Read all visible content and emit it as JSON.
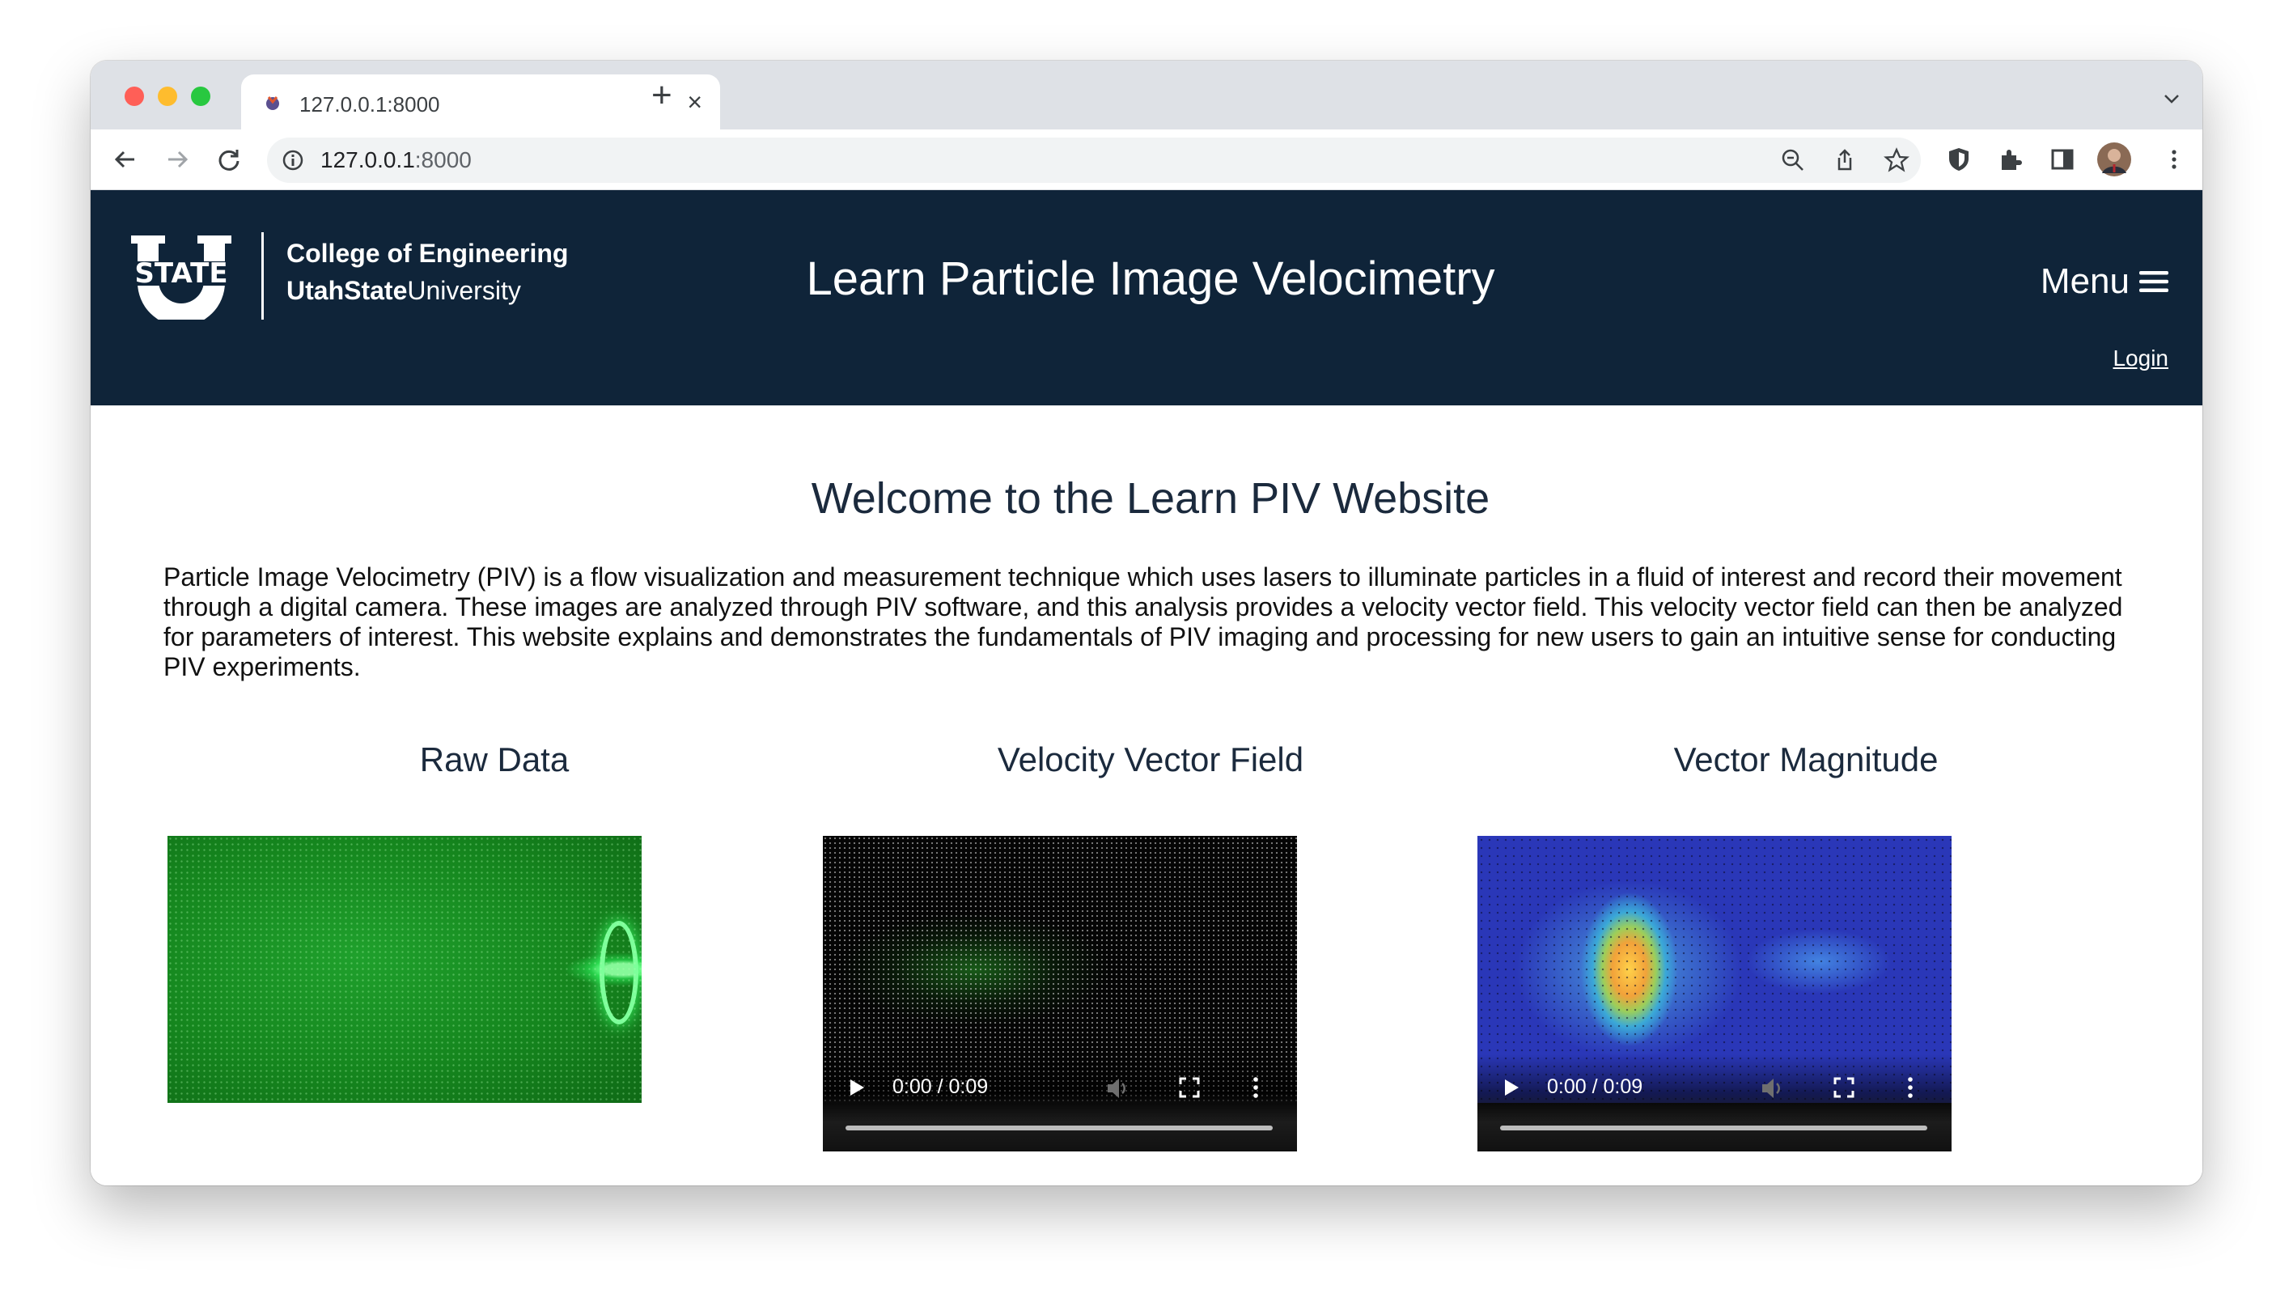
{
  "browser": {
    "tab_title": "127.0.0.1:8000",
    "url_host": "127.0.0.1",
    "url_port": ":8000",
    "new_tab_symbol": "+",
    "close_symbol": "×"
  },
  "header": {
    "college": "College of Engineering",
    "university_bold": "UtahState",
    "university_regular": "University",
    "site_title": "Learn Particle Image Velocimetry",
    "menu_label": "Menu",
    "login_label": "Login",
    "logo_text": "STATE",
    "background_color": "#0f2439"
  },
  "main": {
    "welcome": "Welcome to the Learn PIV Website",
    "intro": "Particle Image Velocimetry (PIV) is a flow visualization and measurement technique which uses lasers to illuminate particles in a fluid of interest and record their movement through a digital camera. These images are analyzed through PIV software, and this analysis provides a velocity vector field. This velocity vector field can then be analyzed for parameters of interest. This website explains and demonstrates the fundamentals of PIV imaging and processing for new users to gain an intuitive sense for conducting PIV experiments.",
    "columns": [
      {
        "heading": "Raw Data"
      },
      {
        "heading": "Velocity Vector Field",
        "video_time": "0:00 / 0:09"
      },
      {
        "heading": "Vector Magnitude",
        "video_time": "0:00 / 0:09"
      }
    ]
  }
}
